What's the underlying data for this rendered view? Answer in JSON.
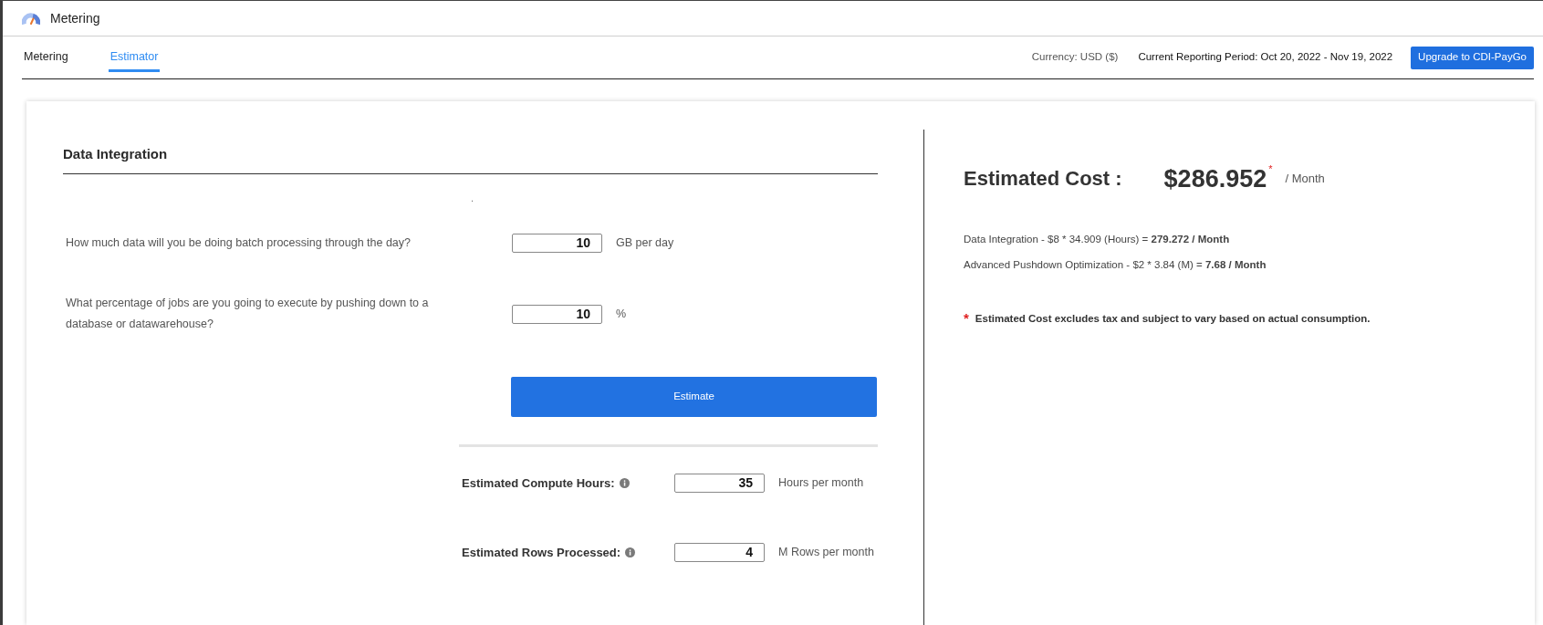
{
  "header": {
    "title": "Metering"
  },
  "tabs": [
    {
      "label": "Metering",
      "selected": false
    },
    {
      "label": "Estimator",
      "selected": true
    }
  ],
  "period_info": {
    "currency": "Currency: USD ($)",
    "reporting_period": "Current Reporting Period: Oct 20, 2022 - Nov 19, 2022",
    "upgrade_button": "Upgrade to CDI-PayGo"
  },
  "estimator": {
    "title": "Data Integration",
    "stray_mark": ".",
    "questions": [
      {
        "text": "How much data will you be doing batch processing through the day?",
        "value": "10",
        "unit": "GB per day"
      },
      {
        "text": "What percentage of jobs are you going to execute by pushing down to a database or datawarehouse?",
        "value": "10",
        "unit": "%"
      }
    ],
    "estimate_button": "Estimate",
    "results": [
      {
        "label": "Estimated Compute Hours:",
        "value": "35",
        "unit": "Hours per month"
      },
      {
        "label": "Estimated Rows Processed:",
        "value": "4",
        "unit": "M Rows per month"
      }
    ]
  },
  "cost": {
    "title": "Estimated Cost :",
    "amount": "$286.952",
    "footnote_mark": "*",
    "period": "/ Month",
    "breakdown": [
      "Data Integration - $8 * 34.909 (Hours) = **279.272 / Month**",
      "Advanced Pushdown Optimization - $2 * 3.84 (M) = **7.68 / Month**"
    ],
    "note_mark": "*",
    "note": "Estimated Cost excludes tax and subject to vary based on actual consumption."
  }
}
